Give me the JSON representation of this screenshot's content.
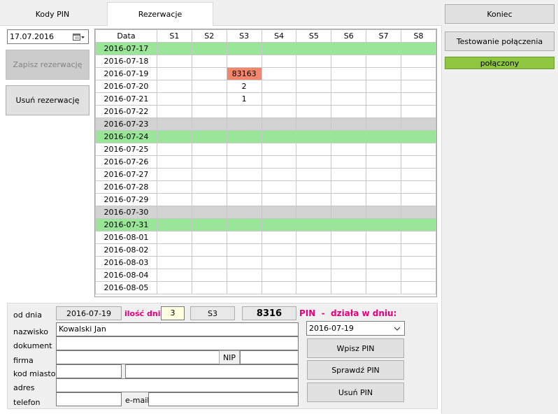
{
  "tabs": [
    {
      "label": "Kody PIN",
      "active": false
    },
    {
      "label": "Rezerwacje",
      "active": true
    }
  ],
  "date_picker": {
    "value": "17.07.2016",
    "icon": "calendar-icon"
  },
  "buttons": {
    "save_reservation": "Zapisz rezerwację",
    "delete_reservation": "Usuń rezerwację",
    "exit": "Koniec",
    "test_connection": "Testowanie połączenia",
    "write_pin": "Wpisz PIN",
    "check_pin": "Sprawdź PIN",
    "delete_pin": "Usuń PIN"
  },
  "status": {
    "label": "połączony",
    "color": "#8ec63f"
  },
  "grid": {
    "headers": [
      "Data",
      "S1",
      "S2",
      "S3",
      "S4",
      "S5",
      "S6",
      "S7",
      "S8"
    ],
    "rows": [
      {
        "date": "2016-07-17",
        "style": "green",
        "cells": [
          "",
          "",
          "",
          "",
          "",
          "",
          "",
          ""
        ]
      },
      {
        "date": "2016-07-18",
        "style": "",
        "cells": [
          "",
          "",
          "",
          "",
          "",
          "",
          "",
          ""
        ]
      },
      {
        "date": "2016-07-19",
        "style": "",
        "cells": [
          "",
          "",
          "83163",
          "",
          "",
          "",
          "",
          ""
        ],
        "highlight": 2
      },
      {
        "date": "2016-07-20",
        "style": "",
        "cells": [
          "",
          "",
          "2",
          "",
          "",
          "",
          "",
          ""
        ]
      },
      {
        "date": "2016-07-21",
        "style": "",
        "cells": [
          "",
          "",
          "1",
          "",
          "",
          "",
          "",
          ""
        ]
      },
      {
        "date": "2016-07-22",
        "style": "",
        "cells": [
          "",
          "",
          "",
          "",
          "",
          "",
          "",
          ""
        ]
      },
      {
        "date": "2016-07-23",
        "style": "grey",
        "cells": [
          "",
          "",
          "",
          "",
          "",
          "",
          "",
          ""
        ]
      },
      {
        "date": "2016-07-24",
        "style": "green",
        "cells": [
          "",
          "",
          "",
          "",
          "",
          "",
          "",
          ""
        ]
      },
      {
        "date": "2016-07-25",
        "style": "",
        "cells": [
          "",
          "",
          "",
          "",
          "",
          "",
          "",
          ""
        ]
      },
      {
        "date": "2016-07-26",
        "style": "",
        "cells": [
          "",
          "",
          "",
          "",
          "",
          "",
          "",
          ""
        ]
      },
      {
        "date": "2016-07-27",
        "style": "",
        "cells": [
          "",
          "",
          "",
          "",
          "",
          "",
          "",
          ""
        ]
      },
      {
        "date": "2016-07-28",
        "style": "",
        "cells": [
          "",
          "",
          "",
          "",
          "",
          "",
          "",
          ""
        ]
      },
      {
        "date": "2016-07-29",
        "style": "",
        "cells": [
          "",
          "",
          "",
          "",
          "",
          "",
          "",
          ""
        ]
      },
      {
        "date": "2016-07-30",
        "style": "grey",
        "cells": [
          "",
          "",
          "",
          "",
          "",
          "",
          "",
          ""
        ]
      },
      {
        "date": "2016-07-31",
        "style": "green",
        "cells": [
          "",
          "",
          "",
          "",
          "",
          "",
          "",
          ""
        ]
      },
      {
        "date": "2016-08-01",
        "style": "",
        "cells": [
          "",
          "",
          "",
          "",
          "",
          "",
          "",
          ""
        ]
      },
      {
        "date": "2016-08-02",
        "style": "",
        "cells": [
          "",
          "",
          "",
          "",
          "",
          "",
          "",
          ""
        ]
      },
      {
        "date": "2016-08-03",
        "style": "",
        "cells": [
          "",
          "",
          "",
          "",
          "",
          "",
          "",
          ""
        ]
      },
      {
        "date": "2016-08-04",
        "style": "",
        "cells": [
          "",
          "",
          "",
          "",
          "",
          "",
          "",
          ""
        ]
      },
      {
        "date": "2016-08-05",
        "style": "",
        "cells": [
          "",
          "",
          "",
          "",
          "",
          "",
          "",
          ""
        ]
      }
    ]
  },
  "form": {
    "labels": {
      "from_date": "od dnia",
      "days_count": "ilość dni",
      "pin_active": "PIN  -  działa w dniu:",
      "name": "nazwisko",
      "document": "dokument",
      "company": "firma",
      "zip_city": "kod  miasto",
      "address": "adres",
      "phone": "telefon",
      "nip": "NIP",
      "email": "e-mail"
    },
    "from_date": "2016-07-19",
    "days_count": "3",
    "slot": "S3",
    "pin": "8316",
    "pin_day": "2016-07-19",
    "name": "Kowalski Jan",
    "document": "",
    "company": "",
    "nip": "",
    "zip": "",
    "city": "",
    "address": "",
    "phone": "",
    "email": ""
  },
  "colors": {
    "magenta": "#e6007e",
    "green_row": "#99e699",
    "grey_row": "#d3d3d3",
    "highlight": "#f4876b"
  }
}
